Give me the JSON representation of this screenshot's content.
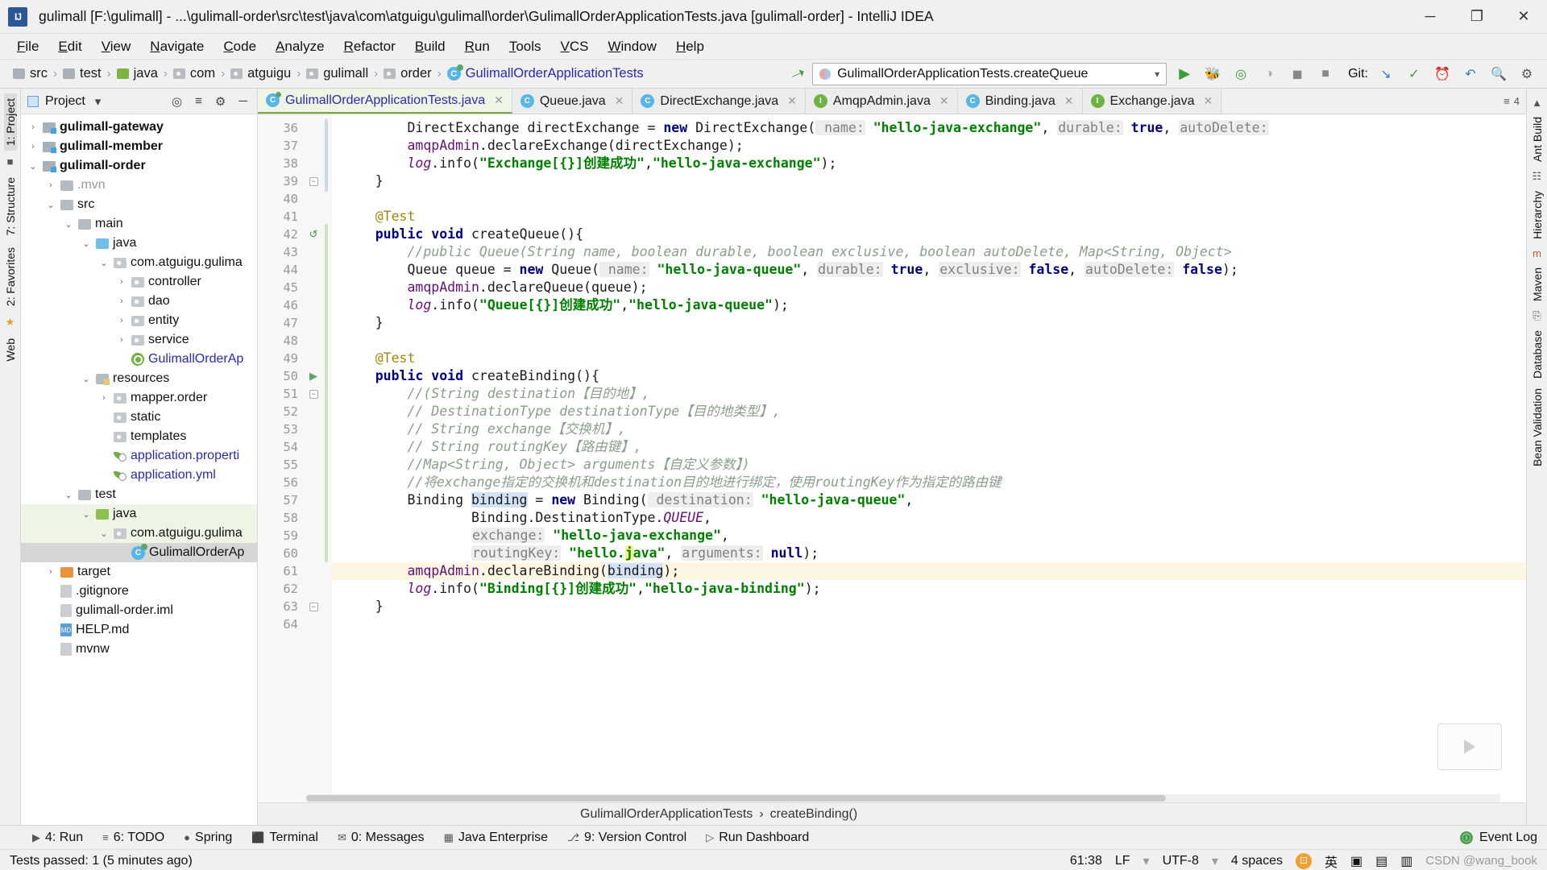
{
  "window": {
    "title": "gulimall [F:\\gulimall] - ...\\gulimall-order\\src\\test\\java\\com\\atguigu\\gulimall\\order\\GulimallOrderApplicationTests.java [gulimall-order] - IntelliJ IDEA",
    "minimize": "─",
    "maximize": "❐",
    "close": "✕"
  },
  "menu": [
    "File",
    "Edit",
    "View",
    "Navigate",
    "Code",
    "Analyze",
    "Refactor",
    "Build",
    "Run",
    "Tools",
    "VCS",
    "Window",
    "Help"
  ],
  "breadcrumb": [
    {
      "label": "src",
      "icon": "folder-icon",
      "kind": "gray"
    },
    {
      "label": "test",
      "icon": "folder-icon",
      "kind": "gray"
    },
    {
      "label": "java",
      "icon": "folder-icon",
      "kind": "green"
    },
    {
      "label": "com",
      "icon": "package-icon",
      "kind": "pkg"
    },
    {
      "label": "atguigu",
      "icon": "package-icon",
      "kind": "pkg"
    },
    {
      "label": "gulimall",
      "icon": "package-icon",
      "kind": "pkg"
    },
    {
      "label": "order",
      "icon": "package-icon",
      "kind": "pkg"
    },
    {
      "label": "GulimallOrderApplicationTests",
      "icon": "class-test-icon",
      "kind": "class"
    }
  ],
  "toolbar": {
    "run_config": "GulimallOrderApplicationTests.createQueue",
    "run_icon": "run-icon",
    "debug_icon": "debug-icon",
    "run_coverage_icon": "run-with-coverage-icon",
    "profiler_icon": "profiler-icon",
    "stop_icon": "stop-icon",
    "git_label": "Git:",
    "git_update_icon": "update-project-icon",
    "git_commit_icon": "commit-icon",
    "git_history_icon": "history-icon",
    "git_rollback_icon": "rollback-icon",
    "search_icon": "search-icon",
    "settings_icon": "settings-icon"
  },
  "project_panel": {
    "title": "Project",
    "caret": "▾",
    "locate_icon": "locate-file-icon",
    "collapse_icon": "collapse-all-icon",
    "settings_icon": "gear-icon",
    "hide_icon": "hide-icon",
    "tree": [
      {
        "label": "gulimall-gateway",
        "depth": 0,
        "arrow": "›",
        "icon": "module-icon",
        "style": "bold"
      },
      {
        "label": "gulimall-member",
        "depth": 0,
        "arrow": "›",
        "icon": "module-icon",
        "style": "bold"
      },
      {
        "label": "gulimall-order",
        "depth": 0,
        "arrow": "⌄",
        "icon": "module-icon",
        "style": "bold"
      },
      {
        "label": ".mvn",
        "depth": 1,
        "arrow": "›",
        "icon": "folder-gray-icon",
        "style": "gray"
      },
      {
        "label": "src",
        "depth": 1,
        "arrow": "⌄",
        "icon": "folder-gray-icon",
        "style": "normal"
      },
      {
        "label": "main",
        "depth": 2,
        "arrow": "⌄",
        "icon": "folder-gray-icon",
        "style": "normal"
      },
      {
        "label": "java",
        "depth": 3,
        "arrow": "⌄",
        "icon": "folder-blue-icon",
        "style": "normal"
      },
      {
        "label": "com.atguigu.gulima",
        "depth": 4,
        "arrow": "⌄",
        "icon": "package-icon",
        "style": "normal"
      },
      {
        "label": "controller",
        "depth": 5,
        "arrow": "›",
        "icon": "package-icon",
        "style": "normal"
      },
      {
        "label": "dao",
        "depth": 5,
        "arrow": "›",
        "icon": "package-icon",
        "style": "normal"
      },
      {
        "label": "entity",
        "depth": 5,
        "arrow": "›",
        "icon": "package-icon",
        "style": "normal"
      },
      {
        "label": "service",
        "depth": 5,
        "arrow": "›",
        "icon": "package-icon",
        "style": "normal"
      },
      {
        "label": "GulimallOrderAp",
        "depth": 5,
        "arrow": "",
        "icon": "spring-class-icon",
        "style": "blue"
      },
      {
        "label": "resources",
        "depth": 3,
        "arrow": "⌄",
        "icon": "resources-folder-icon",
        "style": "normal"
      },
      {
        "label": "mapper.order",
        "depth": 4,
        "arrow": "›",
        "icon": "package-icon",
        "style": "normal"
      },
      {
        "label": "static",
        "depth": 4,
        "arrow": "",
        "icon": "package-icon",
        "style": "normal"
      },
      {
        "label": "templates",
        "depth": 4,
        "arrow": "",
        "icon": "package-icon",
        "style": "normal"
      },
      {
        "label": "application.properti",
        "depth": 4,
        "arrow": "",
        "icon": "spring-leaf-icon",
        "style": "blue"
      },
      {
        "label": "application.yml",
        "depth": 4,
        "arrow": "",
        "icon": "spring-leaf-icon",
        "style": "blue"
      },
      {
        "label": "test",
        "depth": 2,
        "arrow": "⌄",
        "icon": "folder-gray-icon",
        "style": "normal"
      },
      {
        "label": "java",
        "depth": 3,
        "arrow": "⌄",
        "icon": "folder-green-icon",
        "style": "normal",
        "highlight": true
      },
      {
        "label": "com.atguigu.gulima",
        "depth": 4,
        "arrow": "⌄",
        "icon": "package-icon",
        "style": "normal",
        "highlight": true
      },
      {
        "label": "GulimallOrderAp",
        "depth": 5,
        "arrow": "",
        "icon": "class-test-icon",
        "style": "normal",
        "selected": true
      },
      {
        "label": "target",
        "depth": 1,
        "arrow": "›",
        "icon": "folder-orange-icon",
        "style": "normal"
      },
      {
        "label": ".gitignore",
        "depth": 1,
        "arrow": "",
        "icon": "file-icon",
        "style": "normal"
      },
      {
        "label": "gulimall-order.iml",
        "depth": 1,
        "arrow": "",
        "icon": "iml-file-icon",
        "style": "normal"
      },
      {
        "label": "HELP.md",
        "depth": 1,
        "arrow": "",
        "icon": "markdown-file-icon",
        "style": "normal"
      },
      {
        "label": "mvnw",
        "depth": 1,
        "arrow": "",
        "icon": "file-icon",
        "style": "normal"
      }
    ]
  },
  "left_strip": [
    "1: Project",
    "7: Structure",
    "2: Favorites",
    "Web"
  ],
  "right_strip": [
    "Ant Build",
    "Hierarchy",
    "Maven",
    "Database",
    "Bean Validation"
  ],
  "tabs": [
    {
      "label": "GulimallOrderApplicationTests.java",
      "icon": "class-test-icon",
      "active": true,
      "close": "✕"
    },
    {
      "label": "Queue.java",
      "icon": "class-icon",
      "active": false,
      "close": "✕"
    },
    {
      "label": "DirectExchange.java",
      "icon": "class-icon",
      "active": false,
      "close": "✕"
    },
    {
      "label": "AmqpAdmin.java",
      "icon": "interface-icon",
      "active": false,
      "close": "✕"
    },
    {
      "label": "Binding.java",
      "icon": "class-icon",
      "active": false,
      "close": "✕"
    },
    {
      "label": "Exchange.java",
      "icon": "interface-icon",
      "active": false,
      "close": "✕"
    }
  ],
  "editor": {
    "first_line": 36,
    "lines": [
      {
        "n": 36,
        "html": "        <span class='cls'>DirectExchange</span> directExchange = <span class='kw'>new</span> DirectExchange(<span class='hint'> name:</span> <span class='str'>\"hello-java-exchange\"</span>, <span class='hint'>durable:</span> <span class='kw'>true</span>, <span class='hint'>autoDelete:</span>"
      },
      {
        "n": 37,
        "html": "        <span class='fld2'>amqpAdmin</span>.declareExchange(directExchange);"
      },
      {
        "n": 38,
        "html": "        <span class='fld'>log</span>.info(<span class='str'>\"Exchange[{}]<span class='zh'>创建成功</span>\"</span>,<span class='str'>\"hello-java-exchange\"</span>);"
      },
      {
        "n": 39,
        "html": "    }"
      },
      {
        "n": 40,
        "html": ""
      },
      {
        "n": 41,
        "html": "    <span class='ann'>@Test</span>"
      },
      {
        "n": 42,
        "html": "    <span class='kw'>public</span> <span class='kw'>void</span> createQueue(){"
      },
      {
        "n": 43,
        "html": "        <span class='cmt'>//public Queue(String name, boolean durable, boolean exclusive, boolean autoDelete, Map&lt;String, Object&gt;</span>"
      },
      {
        "n": 44,
        "html": "        Queue queue = <span class='kw'>new</span> Queue(<span class='hint'> name:</span> <span class='str'>\"hello-java-queue\"</span>, <span class='hint'>durable:</span> <span class='kw'>true</span>, <span class='hint'>exclusive:</span> <span class='kw'>false</span>, <span class='hint'>autoDelete:</span> <span class='kw'>false</span>);"
      },
      {
        "n": 45,
        "html": "        <span class='fld2'>amqpAdmin</span>.declareQueue(queue);"
      },
      {
        "n": 46,
        "html": "        <span class='fld'>log</span>.info(<span class='str'>\"Queue[{}]<span class='zh'>创建成功</span>\"</span>,<span class='str'>\"hello-java-queue\"</span>);"
      },
      {
        "n": 47,
        "html": "    }"
      },
      {
        "n": 48,
        "html": ""
      },
      {
        "n": 49,
        "html": "    <span class='ann'>@Test</span>"
      },
      {
        "n": 50,
        "html": "    <span class='kw'>public</span> <span class='kw'>void</span> createBinding(){"
      },
      {
        "n": 51,
        "html": "        <span class='cmt'>//(String destination<span class='zh'>【目的地】</span>,</span>"
      },
      {
        "n": 52,
        "html": "        <span class='cmt'>// DestinationType destinationType<span class='zh'>【目的地类型】</span>,</span>"
      },
      {
        "n": 53,
        "html": "        <span class='cmt'>// String exchange<span class='zh'>【交换机】</span>,</span>"
      },
      {
        "n": 54,
        "html": "        <span class='cmt'>// String routingKey<span class='zh'>【路由键】</span>,</span>"
      },
      {
        "n": 55,
        "html": "        <span class='cmt'>//Map&lt;String, Object&gt; arguments<span class='zh'>【自定义参数】</span>)</span>"
      },
      {
        "n": 56,
        "html": "        <span class='cmt'>//<span class='zh'>将</span>exchange<span class='zh'>指定的交换机和</span>destination<span class='zh'>目的地进行绑定，使用</span>routingKey<span class='zh'>作为指定的路由键</span></span>"
      },
      {
        "n": 57,
        "html": "        Binding <span class='hlword'>binding</span> = <span class='kw'>new</span> Binding(<span class='hint'> destination:</span> <span class='str'>\"hello-java-queue\"</span>,"
      },
      {
        "n": 58,
        "html": "                Binding.DestinationType.<span class='fld'>QUEUE</span>,"
      },
      {
        "n": 59,
        "html": "                <span class='hint'>exchange:</span> <span class='str'>\"hello-java-exchange\"</span>,"
      },
      {
        "n": 60,
        "html": "                <span class='hint'>routingKey:</span> <span class='str'>\"hello.<span class='caretw'>j</span>ava\"</span>, <span class='hint'>arguments:</span> <span class='kw'>null</span>);"
      },
      {
        "n": 61,
        "html": "        <span class='fld2'>amqpAdmin</span>.declareBinding(<span class='hlword'>binding</span>);",
        "highlight": true
      },
      {
        "n": 62,
        "html": "        <span class='fld'>log</span>.info(<span class='str'>\"Binding[{}]<span class='zh'>创建成功</span>\"</span>,<span class='str'>\"hello-java-binding\"</span>);"
      },
      {
        "n": 63,
        "html": "    }"
      },
      {
        "n": 64,
        "html": ""
      }
    ]
  },
  "editor_breadcrumb": [
    "GulimallOrderApplicationTests",
    "createBinding()"
  ],
  "editor_breadcrumb_sep": "›",
  "bottom_tools": [
    {
      "label": "4: Run",
      "icon": "run-icon"
    },
    {
      "label": "6: TODO",
      "icon": "todo-icon"
    },
    {
      "label": "Spring",
      "icon": "spring-icon"
    },
    {
      "label": "Terminal",
      "icon": "terminal-icon"
    },
    {
      "label": "0: Messages",
      "icon": "messages-icon"
    },
    {
      "label": "Java Enterprise",
      "icon": "java-enterprise-icon"
    },
    {
      "label": "9: Version Control",
      "icon": "version-control-icon"
    },
    {
      "label": "Run Dashboard",
      "icon": "dashboard-icon"
    }
  ],
  "event_log": {
    "label": "Event Log",
    "icon": "event-log-icon"
  },
  "status": {
    "message": "Tests passed: 1 (5 minutes ago)",
    "caret": "61:38",
    "line_sep": "LF",
    "encoding": "UTF-8",
    "indent": "4 spaces",
    "ime": "英",
    "watermark": "CSDN @wang_book"
  }
}
